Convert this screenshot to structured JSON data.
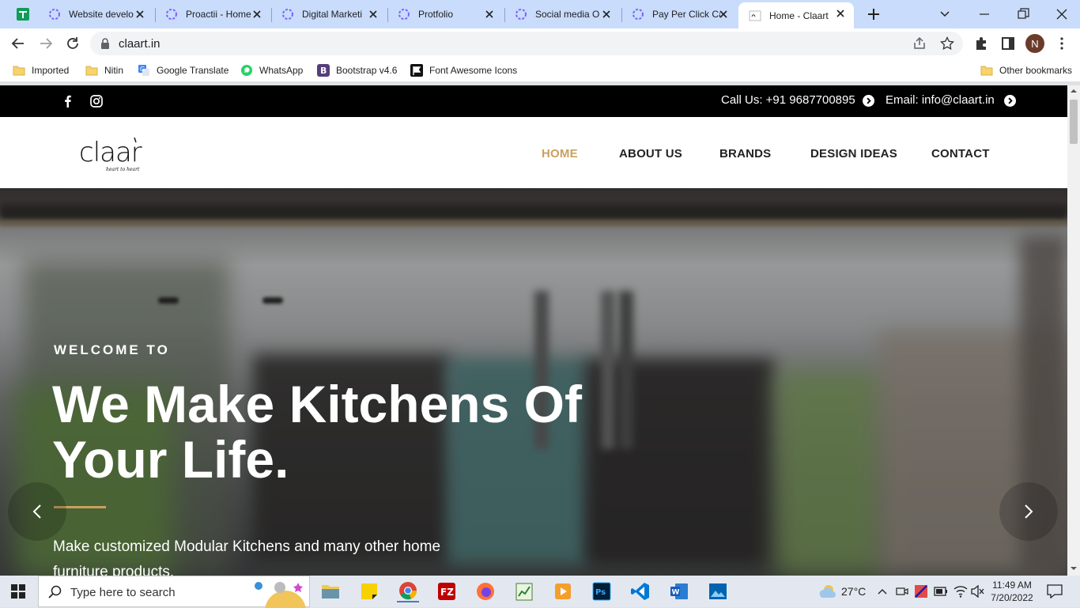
{
  "browser": {
    "tabs": [
      {
        "title": "Website develo",
        "active": false
      },
      {
        "title": "Proactii - Home",
        "active": false
      },
      {
        "title": "Digital Marketi",
        "active": false
      },
      {
        "title": "Protfolio",
        "active": false
      },
      {
        "title": "Social media O",
        "active": false
      },
      {
        "title": "Pay Per Click Ca",
        "active": false
      },
      {
        "title": "Home - Claart",
        "active": true
      }
    ],
    "url": "claart.in",
    "profile_initial": "N",
    "bookmarks": [
      {
        "label": "Imported",
        "icon": "folder-icon"
      },
      {
        "label": "Nitin",
        "icon": "folder-icon"
      },
      {
        "label": "Google Translate",
        "icon": "translate-icon"
      },
      {
        "label": "WhatsApp",
        "icon": "whatsapp-icon"
      },
      {
        "label": "Bootstrap v4.6",
        "icon": "bootstrap-icon"
      },
      {
        "label": "Font Awesome Icons",
        "icon": "flag-icon"
      }
    ],
    "other_bookmarks": "Other bookmarks"
  },
  "site": {
    "topbar": {
      "phone": "Call Us: +91 9687700895",
      "email": "Email: info@claart.in"
    },
    "logo_text": "claart",
    "logo_tagline": "heart to heart",
    "nav": [
      {
        "label": "HOME",
        "active": true
      },
      {
        "label": "ABOUT US",
        "active": false
      },
      {
        "label": "BRANDS",
        "active": false
      },
      {
        "label": "DESIGN IDEAS",
        "active": false
      },
      {
        "label": "CONTACT",
        "active": false
      }
    ],
    "hero": {
      "welcome": "WELCOME TO",
      "headline": "We Make Kitchens Of Your Life.",
      "tagline": "Make customized Modular Kitchens and many other home furniture products."
    },
    "colors": {
      "accent": "#c9a15f",
      "topbar": "#000000"
    }
  },
  "taskbar": {
    "search_placeholder": "Type here to search",
    "weather": "27°C",
    "time": "11:49 AM",
    "date": "7/20/2022"
  }
}
